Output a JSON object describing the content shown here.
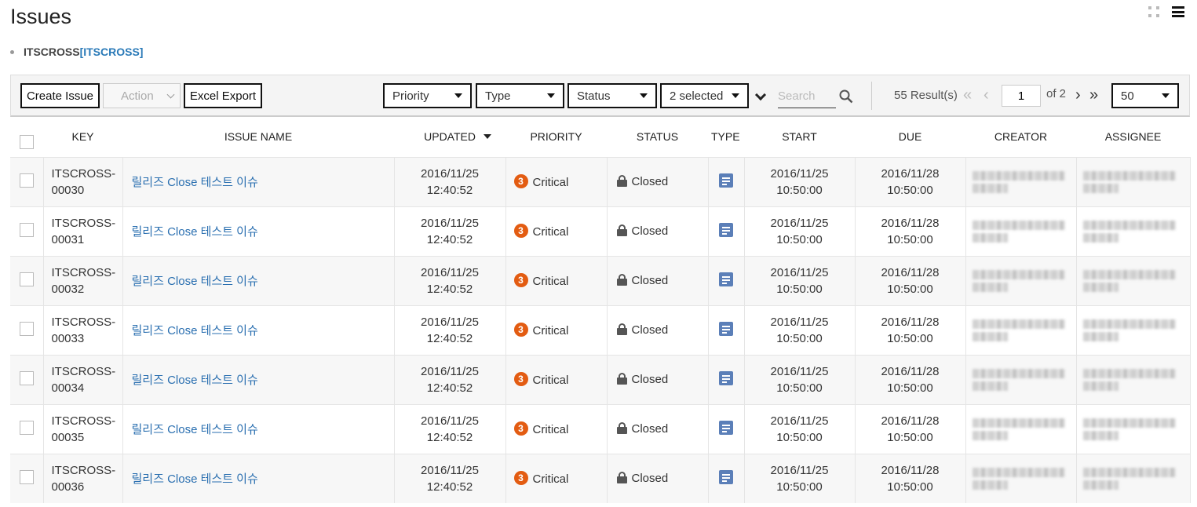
{
  "page": {
    "title": "Issues"
  },
  "breadcrumb": {
    "project": "ITSCROSS",
    "link": "[ITSCROSS]"
  },
  "toolbar": {
    "create_label": "Create Issue",
    "action_label": "Action",
    "export_label": "Excel Export",
    "filters": {
      "priority": "Priority",
      "type": "Type",
      "status": "Status",
      "selected": "2 selected"
    },
    "search_placeholder": "Search",
    "results": "55 Result(s)",
    "current_page": "1",
    "of_pages": "of 2",
    "page_size": "50"
  },
  "table": {
    "columns": {
      "key": "KEY",
      "name": "ISSUE NAME",
      "updated": "UPDATED",
      "priority": "PRIORITY",
      "status": "STATUS",
      "type": "TYPE",
      "start": "START",
      "due": "DUE",
      "creator": "CREATOR",
      "assignee": "ASSIGNEE"
    },
    "sort": {
      "column": "UPDATED",
      "direction": "descending"
    },
    "rows": [
      {
        "key_a": "ITSCROSS-",
        "key_b": "00030",
        "name": "릴리즈 Close 테스트 이슈",
        "upd_date": "2016/11/25",
        "upd_time": "12:40:52",
        "prio_num": "3",
        "priority": "Critical",
        "status": "Closed",
        "start_date": "2016/11/25",
        "start_time": "10:50:00",
        "due_date": "2016/11/28",
        "due_time": "10:50:00"
      },
      {
        "key_a": "ITSCROSS-",
        "key_b": "00031",
        "name": "릴리즈 Close 테스트 이슈",
        "upd_date": "2016/11/25",
        "upd_time": "12:40:52",
        "prio_num": "3",
        "priority": "Critical",
        "status": "Closed",
        "start_date": "2016/11/25",
        "start_time": "10:50:00",
        "due_date": "2016/11/28",
        "due_time": "10:50:00"
      },
      {
        "key_a": "ITSCROSS-",
        "key_b": "00032",
        "name": "릴리즈 Close 테스트 이슈",
        "upd_date": "2016/11/25",
        "upd_time": "12:40:52",
        "prio_num": "3",
        "priority": "Critical",
        "status": "Closed",
        "start_date": "2016/11/25",
        "start_time": "10:50:00",
        "due_date": "2016/11/28",
        "due_time": "10:50:00"
      },
      {
        "key_a": "ITSCROSS-",
        "key_b": "00033",
        "name": "릴리즈 Close 테스트 이슈",
        "upd_date": "2016/11/25",
        "upd_time": "12:40:52",
        "prio_num": "3",
        "priority": "Critical",
        "status": "Closed",
        "start_date": "2016/11/25",
        "start_time": "10:50:00",
        "due_date": "2016/11/28",
        "due_time": "10:50:00"
      },
      {
        "key_a": "ITSCROSS-",
        "key_b": "00034",
        "name": "릴리즈 Close 테스트 이슈",
        "upd_date": "2016/11/25",
        "upd_time": "12:40:52",
        "prio_num": "3",
        "priority": "Critical",
        "status": "Closed",
        "start_date": "2016/11/25",
        "start_time": "10:50:00",
        "due_date": "2016/11/28",
        "due_time": "10:50:00"
      },
      {
        "key_a": "ITSCROSS-",
        "key_b": "00035",
        "name": "릴리즈 Close 테스트 이슈",
        "upd_date": "2016/11/25",
        "upd_time": "12:40:52",
        "prio_num": "3",
        "priority": "Critical",
        "status": "Closed",
        "start_date": "2016/11/25",
        "start_time": "10:50:00",
        "due_date": "2016/11/28",
        "due_time": "10:50:00"
      },
      {
        "key_a": "ITSCROSS-",
        "key_b": "00036",
        "name": "릴리즈 Close 테스트 이슈",
        "upd_date": "2016/11/25",
        "upd_time": "12:40:52",
        "prio_num": "3",
        "priority": "Critical",
        "status": "Closed",
        "start_date": "2016/11/25",
        "start_time": "10:50:00",
        "due_date": "2016/11/28",
        "due_time": "10:50:00"
      }
    ]
  },
  "colors": {
    "link": "#2a6fb0",
    "priority_critical": "#e35c12",
    "type_icon": "#5b7fb8"
  },
  "icons": {
    "type": "document-icon",
    "status": "lock-icon"
  }
}
